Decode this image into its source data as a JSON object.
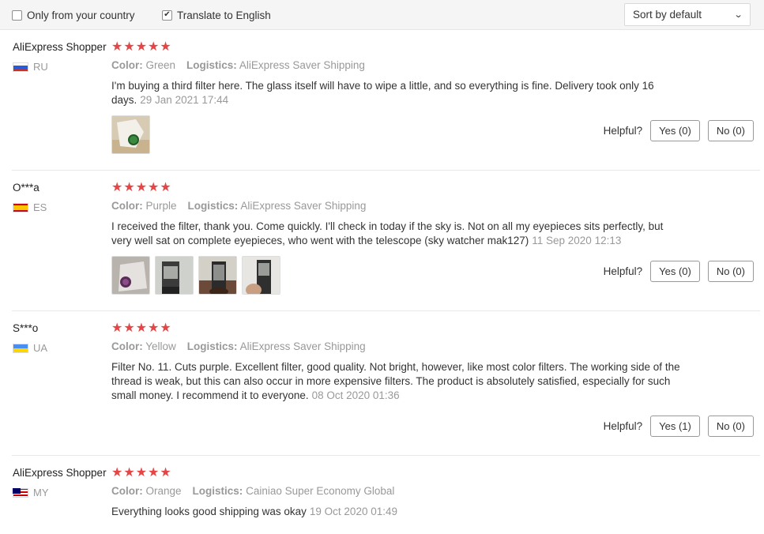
{
  "filters": {
    "only_country": {
      "label": "Only from your country",
      "checked": false
    },
    "translate": {
      "label": "Translate to English",
      "checked": true
    },
    "sort": {
      "label": "Sort by default"
    }
  },
  "labels": {
    "color": "Color:",
    "logistics": "Logistics:",
    "helpful": "Helpful?"
  },
  "reviews": [
    {
      "user": "AliExpress Shopper",
      "country": "RU",
      "stars": 5,
      "color": "Green",
      "logistics": "AliExpress Saver Shipping",
      "text": "I'm buying a third filter here. The glass itself will have to wipe a little, and so everything is fine. Delivery took only 16 days.",
      "date": "29 Jan 2021 17:44",
      "yes": "Yes (0)",
      "no": "No (0)"
    },
    {
      "user": "O***a",
      "country": "ES",
      "stars": 5,
      "color": "Purple",
      "logistics": "AliExpress Saver Shipping",
      "text": "I received the filter, thank you. Come quickly. I'll check in today if the sky is. Not on all my eyepieces sits perfectly, but very well sat on complete eyepieces, who went with the telescope (sky watcher mak127)",
      "date": "11 Sep 2020 12:13",
      "yes": "Yes (0)",
      "no": "No (0)"
    },
    {
      "user": "S***o",
      "country": "UA",
      "stars": 5,
      "color": "Yellow",
      "logistics": "AliExpress Saver Shipping",
      "text": "Filter No. 11. Cuts purple. Excellent filter, good quality. Not bright, however, like most color filters. The working side of the thread is weak, but this can also occur in more expensive filters. The product is absolutely satisfied, especially for such small money. I recommend it to everyone.",
      "date": "08 Oct 2020 01:36",
      "yes": "Yes (1)",
      "no": "No (0)"
    },
    {
      "user": "AliExpress Shopper",
      "country": "MY",
      "stars": 5,
      "color": "Orange",
      "logistics": "Cainiao Super Economy Global",
      "text": "Everything looks good shipping was okay",
      "date": "19 Oct 2020 01:49"
    }
  ]
}
